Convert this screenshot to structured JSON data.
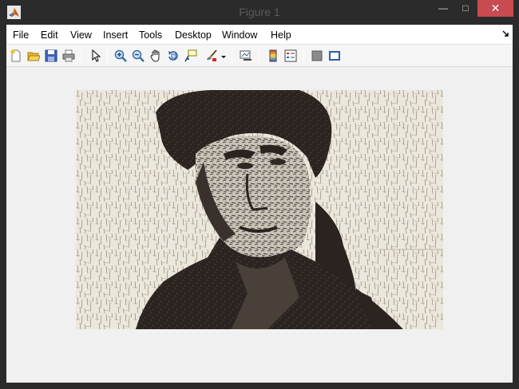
{
  "window": {
    "title": "Figure 1",
    "controls": {
      "minimize": "—",
      "maximize": "□",
      "close": "✕"
    }
  },
  "menu": [
    "File",
    "Edit",
    "View",
    "Insert",
    "Tools",
    "Desktop",
    "Window",
    "Help"
  ],
  "toolbar": [
    {
      "name": "new-figure-icon",
      "tip": "New Figure"
    },
    {
      "name": "open-file-icon",
      "tip": "Open File"
    },
    {
      "name": "save-figure-icon",
      "tip": "Save Figure"
    },
    {
      "name": "print-figure-icon",
      "tip": "Print Figure"
    },
    {
      "name": "edit-plot-arrow-icon",
      "tip": "Edit Plot"
    },
    {
      "name": "zoom-in-icon",
      "tip": "Zoom In"
    },
    {
      "name": "zoom-out-icon",
      "tip": "Zoom Out"
    },
    {
      "name": "pan-hand-icon",
      "tip": "Pan"
    },
    {
      "name": "rotate-3d-icon",
      "tip": "Rotate 3D"
    },
    {
      "name": "data-cursor-icon",
      "tip": "Data Cursor"
    },
    {
      "name": "brush-icon",
      "tip": "Brush/Select Data"
    },
    {
      "name": "link-plot-icon",
      "tip": "Link Plot"
    },
    {
      "name": "insert-colorbar-icon",
      "tip": "Insert Colorbar"
    },
    {
      "name": "insert-legend-icon",
      "tip": "Insert Legend"
    },
    {
      "name": "hide-plot-tools-icon",
      "tip": "Hide Plot Tools"
    },
    {
      "name": "show-plot-tools-icon",
      "tip": "Show Plot Tools and Dock Figure"
    }
  ],
  "colors": {
    "titlebar": "#2b2b2b",
    "close": "#c74b4f",
    "figure_bg": "#f0f0f0",
    "paper": "#ece7dc",
    "ink": "#2a2320"
  }
}
